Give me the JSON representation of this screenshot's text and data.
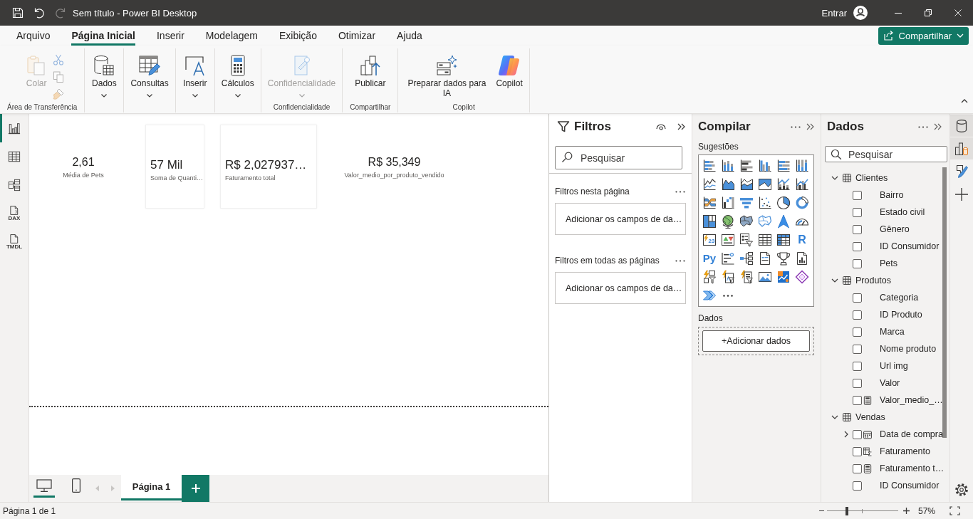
{
  "window": {
    "title": "Sem título - Power BI Desktop",
    "sign_in": "Entrar"
  },
  "quick_access": [
    {
      "kind": "save",
      "disabled": false
    },
    {
      "kind": "undo",
      "disabled": false
    },
    {
      "kind": "redo",
      "disabled": true
    }
  ],
  "ribbon": {
    "tabs": [
      {
        "label": "Arquivo",
        "selected": false
      },
      {
        "label": "Página Inicial",
        "selected": true
      },
      {
        "label": "Inserir",
        "selected": false
      },
      {
        "label": "Modelagem",
        "selected": false
      },
      {
        "label": "Exibição",
        "selected": false
      },
      {
        "label": "Otimizar",
        "selected": false
      },
      {
        "label": "Ajuda",
        "selected": false
      }
    ],
    "share_button": {
      "label": "Compartilhar"
    },
    "groups": [
      {
        "label": "Área de Transferência",
        "buttons": [
          {
            "kind": "paste",
            "label": "Colar",
            "disabled": true,
            "dropdown": false
          }
        ],
        "small_buttons": [
          {
            "kind": "cut",
            "disabled": true
          },
          {
            "kind": "copy",
            "disabled": true
          },
          {
            "kind": "format_painter",
            "disabled": true
          }
        ]
      },
      {
        "buttons": [
          {
            "kind": "data",
            "label": "Dados",
            "disabled": false,
            "dropdown": true
          }
        ]
      },
      {
        "buttons": [
          {
            "kind": "queries",
            "label": "Consultas",
            "disabled": false,
            "dropdown": true
          }
        ]
      },
      {
        "buttons": [
          {
            "kind": "insert",
            "label": "Inserir",
            "disabled": false,
            "dropdown": true
          }
        ]
      },
      {
        "buttons": [
          {
            "kind": "calculations",
            "label": "Cálculos",
            "disabled": false,
            "dropdown": true
          }
        ]
      },
      {
        "label": "Confidencialidade",
        "buttons": [
          {
            "kind": "sensitivity",
            "label": "Confidencialidade",
            "disabled": true,
            "dropdown": true
          }
        ]
      },
      {
        "label": "Compartilhar",
        "buttons": [
          {
            "kind": "publish",
            "label": "Publicar",
            "disabled": false,
            "dropdown": false
          }
        ]
      },
      {
        "label": "Copilot",
        "buttons": [
          {
            "kind": "prep_ai",
            "label": "Preparar dados para IA",
            "disabled": false,
            "dropdown": false
          },
          {
            "kind": "copilot",
            "label": "Copilot",
            "disabled": false,
            "dropdown": false
          }
        ]
      }
    ]
  },
  "left_nav": [
    {
      "kind": "report",
      "selected": true
    },
    {
      "kind": "table",
      "selected": false
    },
    {
      "kind": "model",
      "selected": false
    },
    {
      "kind": "dax",
      "badge": "DAX",
      "selected": false
    },
    {
      "kind": "tmdl",
      "badge": "TMDL",
      "selected": false
    }
  ],
  "canvas": {
    "cards": [
      {
        "kind": "centered",
        "value": "2,61",
        "label": "Média de Pets"
      },
      {
        "kind": "framed",
        "value": "57 Mil",
        "label": "Soma de Quanti…"
      },
      {
        "kind": "framed",
        "value": "R$ 2,027937…",
        "label": "Faturamento total"
      },
      {
        "kind": "centered",
        "value": "R$ 35,349",
        "label": "Valor_medio_por_produto_vendido"
      }
    ]
  },
  "page_bar": {
    "views": [
      {
        "kind": "desktop",
        "selected": true
      },
      {
        "kind": "mobile",
        "selected": false
      }
    ],
    "nav": [
      {
        "kind": "previous",
        "disabled": true
      },
      {
        "kind": "next",
        "disabled": true
      }
    ],
    "pages": [
      {
        "label": "Página 1",
        "selected": true
      }
    ]
  },
  "filters_pane": {
    "title": "Filtros",
    "search": {
      "placeholder": "Pesquisar"
    },
    "sections": [
      {
        "title": "Filtros nesta página",
        "drop_hint": "Adicionar os campos de da…"
      },
      {
        "title": "Filtros em todas as páginas",
        "drop_hint": "Adicionar os campos de da…"
      }
    ]
  },
  "build_pane": {
    "title": "Compilar",
    "suggestions_label": "Sugestões",
    "visuals": [
      {
        "kind": "stacked-bar"
      },
      {
        "kind": "stacked-column"
      },
      {
        "kind": "clustered-bar"
      },
      {
        "kind": "clustered-column"
      },
      {
        "kind": "percent-bar"
      },
      {
        "kind": "percent-column"
      },
      {
        "kind": "line"
      },
      {
        "kind": "area"
      },
      {
        "kind": "stacked-area"
      },
      {
        "kind": "ribbon-area"
      },
      {
        "kind": "line-stacked-column"
      },
      {
        "kind": "line-clustered-column"
      },
      {
        "kind": "ribbon"
      },
      {
        "kind": "waterfall"
      },
      {
        "kind": "funnel"
      },
      {
        "kind": "scatter"
      },
      {
        "kind": "pie"
      },
      {
        "kind": "donut"
      },
      {
        "kind": "treemap"
      },
      {
        "kind": "map"
      },
      {
        "kind": "filled-map"
      },
      {
        "kind": "shape-map"
      },
      {
        "kind": "azure-map"
      },
      {
        "kind": "gauge"
      },
      {
        "kind": "card",
        "glyph": "23"
      },
      {
        "kind": "kpi"
      },
      {
        "kind": "slicer"
      },
      {
        "kind": "table"
      },
      {
        "kind": "matrix"
      },
      {
        "kind": "r-visual",
        "glyph": "R"
      },
      {
        "kind": "python-visual",
        "glyph": "Py"
      },
      {
        "kind": "key-influencers"
      },
      {
        "kind": "decomposition-tree"
      },
      {
        "kind": "qna"
      },
      {
        "kind": "goals"
      },
      {
        "kind": "paginated-report"
      },
      {
        "kind": "bolt-slicer"
      },
      {
        "kind": "bolt-tree"
      },
      {
        "kind": "bolt-list"
      },
      {
        "kind": "image"
      },
      {
        "kind": "arcgis"
      },
      {
        "kind": "power-apps"
      },
      {
        "kind": "power-automate"
      },
      {
        "kind": "more"
      }
    ],
    "data_label": "Dados",
    "add_data_button": "+Adicionar dados"
  },
  "data_pane": {
    "title": "Dados",
    "search": {
      "placeholder": "Pesquisar"
    },
    "tables": [
      {
        "name": "Clientes",
        "expanded": true,
        "children": [
          {
            "name": "Bairro",
            "kind": "column",
            "checked": false
          },
          {
            "name": "Estado civil",
            "kind": "column",
            "checked": false
          },
          {
            "name": "Gênero",
            "kind": "column",
            "checked": false
          },
          {
            "name": "ID Consumidor",
            "kind": "column",
            "checked": false
          },
          {
            "name": "Pets",
            "kind": "column",
            "checked": false
          }
        ]
      },
      {
        "name": "Produtos",
        "expanded": true,
        "children": [
          {
            "name": "Categoria",
            "kind": "column",
            "checked": false
          },
          {
            "name": "ID Produto",
            "kind": "column",
            "checked": false
          },
          {
            "name": "Marca",
            "kind": "column",
            "checked": false
          },
          {
            "name": "Nome produto",
            "kind": "column",
            "checked": false
          },
          {
            "name": "Url img",
            "kind": "column",
            "checked": false
          },
          {
            "name": "Valor",
            "kind": "column",
            "checked": false
          },
          {
            "name": "Valor_medio_…",
            "kind": "measure",
            "checked": false
          }
        ]
      },
      {
        "name": "Vendas",
        "expanded": true,
        "children": [
          {
            "name": "Data de compra",
            "kind": "date",
            "checked": false,
            "expanded": false
          },
          {
            "name": "Faturamento",
            "kind": "calculated_column",
            "checked": false
          },
          {
            "name": "Faturamento t…",
            "kind": "measure",
            "checked": false
          },
          {
            "name": "ID Consumidor",
            "kind": "column",
            "checked": false
          }
        ]
      }
    ]
  },
  "right_rail": [
    {
      "kind": "data",
      "selected": true
    },
    {
      "kind": "build",
      "selected": true
    },
    {
      "kind": "format",
      "selected": false
    },
    {
      "kind": "add",
      "selected": false
    }
  ],
  "status_bar": {
    "page_indicator": "Página 1 de 1",
    "zoom": {
      "level": 0.28,
      "reading": "57%"
    }
  }
}
